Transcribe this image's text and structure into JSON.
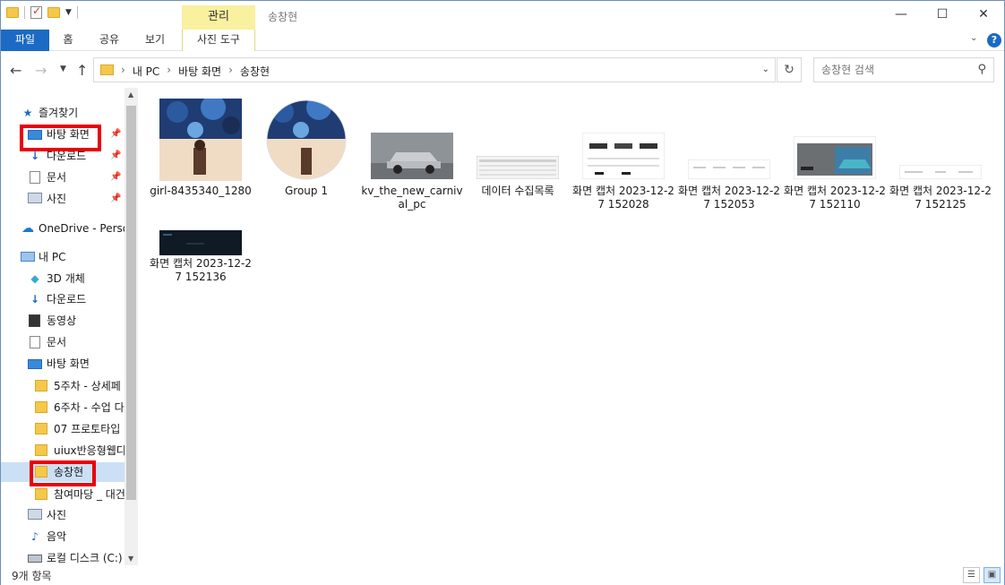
{
  "window": {
    "title": "송창현",
    "contextual_tab": "관리",
    "controls": {
      "minimize": "—",
      "maximize": "☐",
      "close": "✕"
    }
  },
  "ribbon": {
    "tabs": [
      {
        "label": "파일"
      },
      {
        "label": "홈"
      },
      {
        "label": "공유"
      },
      {
        "label": "보기"
      },
      {
        "label": "사진 도구"
      }
    ],
    "help": "?"
  },
  "address": {
    "crumbs": [
      "내 PC",
      "바탕 화면",
      "송창현"
    ],
    "separator": "›"
  },
  "search": {
    "placeholder": "송창현 검색"
  },
  "nav": {
    "items": [
      {
        "label": "즐겨찾기",
        "icon": "star-icon"
      },
      {
        "label": "바탕 화면",
        "icon": "desktop-icon",
        "pinned": true
      },
      {
        "label": "다운로드",
        "icon": "download-icon",
        "pinned": true
      },
      {
        "label": "문서",
        "icon": "document-icon",
        "pinned": true
      },
      {
        "label": "사진",
        "icon": "pictures-icon",
        "pinned": true
      },
      {
        "label": "OneDrive - Personal",
        "icon": "onedrive-icon"
      },
      {
        "label": "내 PC",
        "icon": "pc-icon"
      },
      {
        "label": "3D 개체",
        "icon": "3d-objects-icon"
      },
      {
        "label": "다운로드",
        "icon": "download-icon"
      },
      {
        "label": "동영상",
        "icon": "video-icon"
      },
      {
        "label": "문서",
        "icon": "document-icon"
      },
      {
        "label": "바탕 화면",
        "icon": "desktop-icon"
      },
      {
        "label": "5주차 - 상세페",
        "icon": "folder-icon"
      },
      {
        "label": "6주차 - 수업 다",
        "icon": "folder-icon"
      },
      {
        "label": "07 프로토타입",
        "icon": "folder-icon"
      },
      {
        "label": "uiux반응형웹디",
        "icon": "folder-icon"
      },
      {
        "label": "송창현",
        "icon": "folder-icon",
        "selected": true
      },
      {
        "label": "참여마당 _ 대건",
        "icon": "folder-icon"
      },
      {
        "label": "사진",
        "icon": "pictures-icon"
      },
      {
        "label": "음악",
        "icon": "music-icon"
      },
      {
        "label": "로컬 디스크 (C:)",
        "icon": "disk-icon"
      }
    ]
  },
  "files": [
    {
      "name": "girl-8435340_1280",
      "type": "image"
    },
    {
      "name": "Group 1",
      "type": "image"
    },
    {
      "name": "kv_the_new_carnival_pc",
      "type": "image"
    },
    {
      "name": "데이터 수집목록",
      "type": "image"
    },
    {
      "name": "화면 캡처 2023-12-27 152028",
      "type": "image"
    },
    {
      "name": "화면 캡처 2023-12-27 152053",
      "type": "image"
    },
    {
      "name": "화면 캡처 2023-12-27 152110",
      "type": "image"
    },
    {
      "name": "화면 캡처 2023-12-27 152125",
      "type": "image"
    },
    {
      "name": "화면 캡처 2023-12-27 152136",
      "type": "image"
    }
  ],
  "status": {
    "count": "9개 항목"
  },
  "colors": {
    "accent": "#1b6ac3",
    "contextual_tab": "#f9f0a0",
    "highlight": "#e8000b",
    "selection": "#cce0f5"
  }
}
